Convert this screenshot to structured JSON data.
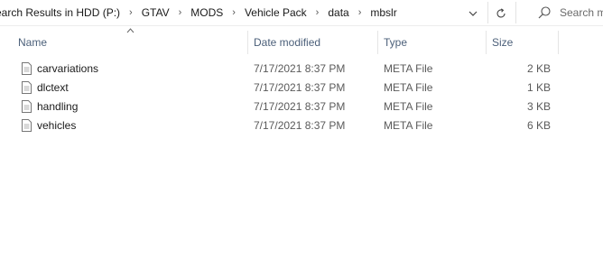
{
  "address": {
    "crumbs": [
      "earch Results in HDD (P:)",
      "GTAV",
      "MODS",
      "Vehicle Pack",
      "data",
      "mbslr"
    ],
    "separator": "›",
    "dropdown_icon": "chevron-down-icon",
    "refresh_icon": "refresh-icon"
  },
  "search": {
    "placeholder": "Search m",
    "icon": "search-icon"
  },
  "columns": {
    "name": "Name",
    "date": "Date modified",
    "type": "Type",
    "size": "Size"
  },
  "files": [
    {
      "name": "carvariations",
      "date": "7/17/2021 8:37 PM",
      "type": "META File",
      "size": "2 KB"
    },
    {
      "name": "dlctext",
      "date": "7/17/2021 8:37 PM",
      "type": "META File",
      "size": "1 KB"
    },
    {
      "name": "handling",
      "date": "7/17/2021 8:37 PM",
      "type": "META File",
      "size": "3 KB"
    },
    {
      "name": "vehicles",
      "date": "7/17/2021 8:37 PM",
      "type": "META File",
      "size": "6 KB"
    }
  ]
}
